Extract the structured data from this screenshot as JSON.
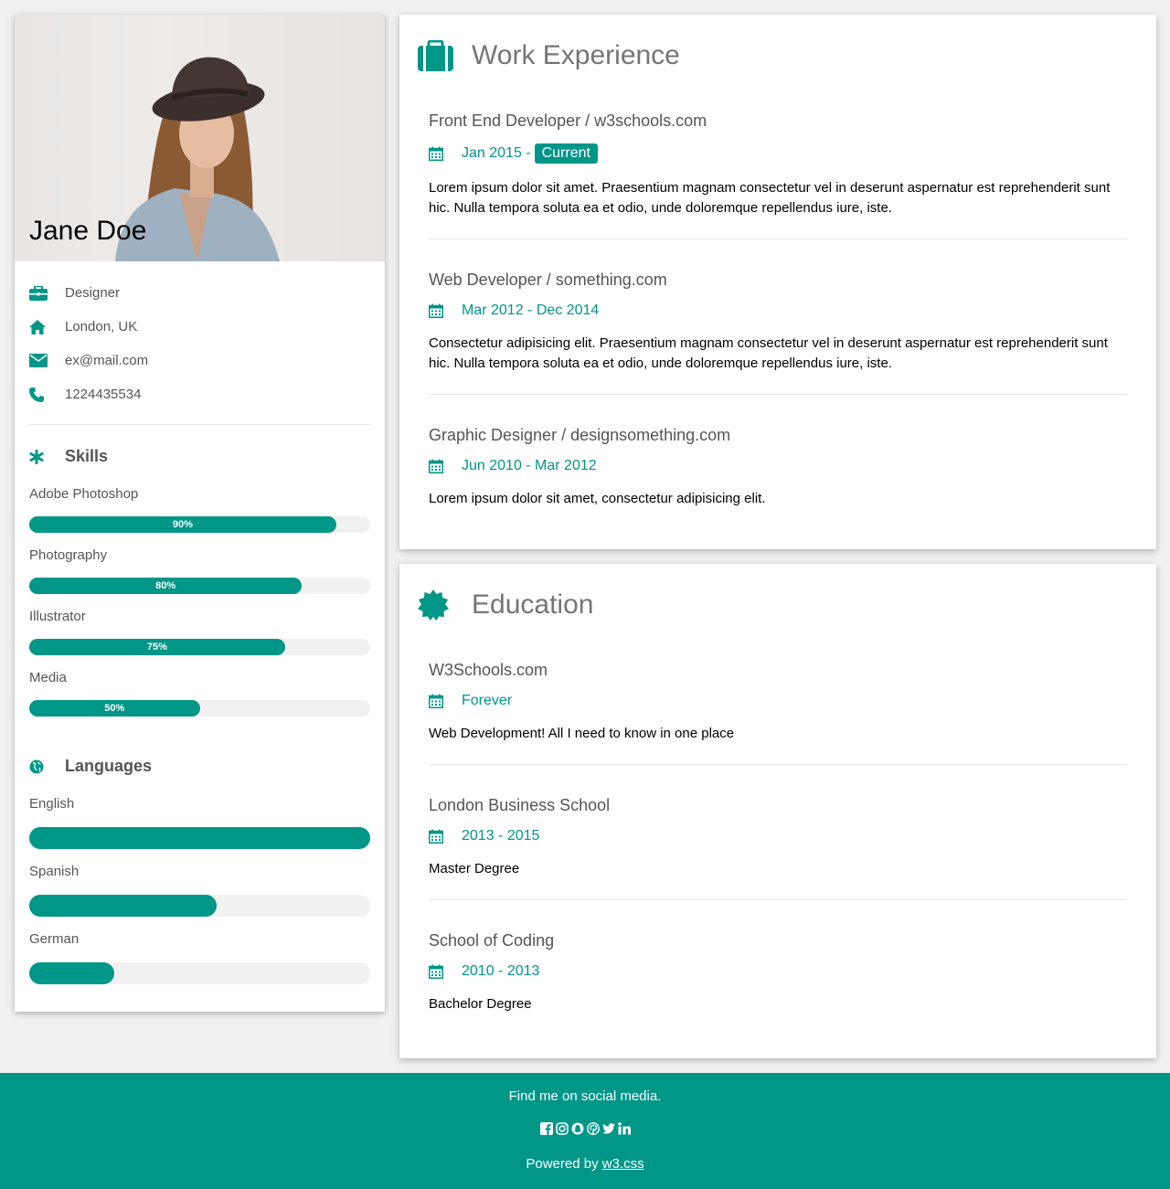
{
  "profile": {
    "name": "Jane Doe",
    "job": "Designer",
    "location": "London, UK",
    "email": "ex@mail.com",
    "phone": "1224435534"
  },
  "skills": {
    "title": "Skills",
    "items": [
      {
        "label": "Adobe Photoshop",
        "percent_label": "90%",
        "value": 90
      },
      {
        "label": "Photography",
        "percent_label": "80%",
        "value": 80
      },
      {
        "label": "Illustrator",
        "percent_label": "75%",
        "value": 75
      },
      {
        "label": "Media",
        "percent_label": "50%",
        "value": 50
      }
    ]
  },
  "languages": {
    "title": "Languages",
    "items": [
      {
        "label": "English",
        "value": 100
      },
      {
        "label": "Spanish",
        "value": 55
      },
      {
        "label": "German",
        "value": 25
      }
    ]
  },
  "work": {
    "title": "Work Experience",
    "entries": [
      {
        "title": "Front End Developer / w3schools.com",
        "date": "Jan 2015 -",
        "tag": "Current",
        "desc": "Lorem ipsum dolor sit amet. Praesentium magnam consectetur vel in deserunt aspernatur est reprehenderit sunt hic. Nulla tempora soluta ea et odio, unde doloremque repellendus iure, iste."
      },
      {
        "title": "Web Developer / something.com",
        "date": "Mar 2012 - Dec 2014",
        "desc": "Consectetur adipisicing elit. Praesentium magnam consectetur vel in deserunt aspernatur est reprehenderit sunt hic. Nulla tempora soluta ea et odio, unde doloremque repellendus iure, iste."
      },
      {
        "title": "Graphic Designer / designsomething.com",
        "date": "Jun 2010 - Mar 2012",
        "desc": "Lorem ipsum dolor sit amet, consectetur adipisicing elit."
      }
    ]
  },
  "education": {
    "title": "Education",
    "entries": [
      {
        "title": "W3Schools.com",
        "date": "Forever",
        "desc": "Web Development! All I need to know in one place"
      },
      {
        "title": "London Business School",
        "date": "2013 - 2015",
        "desc": "Master Degree"
      },
      {
        "title": "School of Coding",
        "date": "2010 - 2013",
        "desc": "Bachelor Degree"
      }
    ]
  },
  "footer": {
    "tagline": "Find me on social media.",
    "powered_prefix": "Powered by ",
    "powered_link": "w3.css"
  },
  "colors": {
    "accent": "#009688",
    "background": "#f1f1f1"
  }
}
